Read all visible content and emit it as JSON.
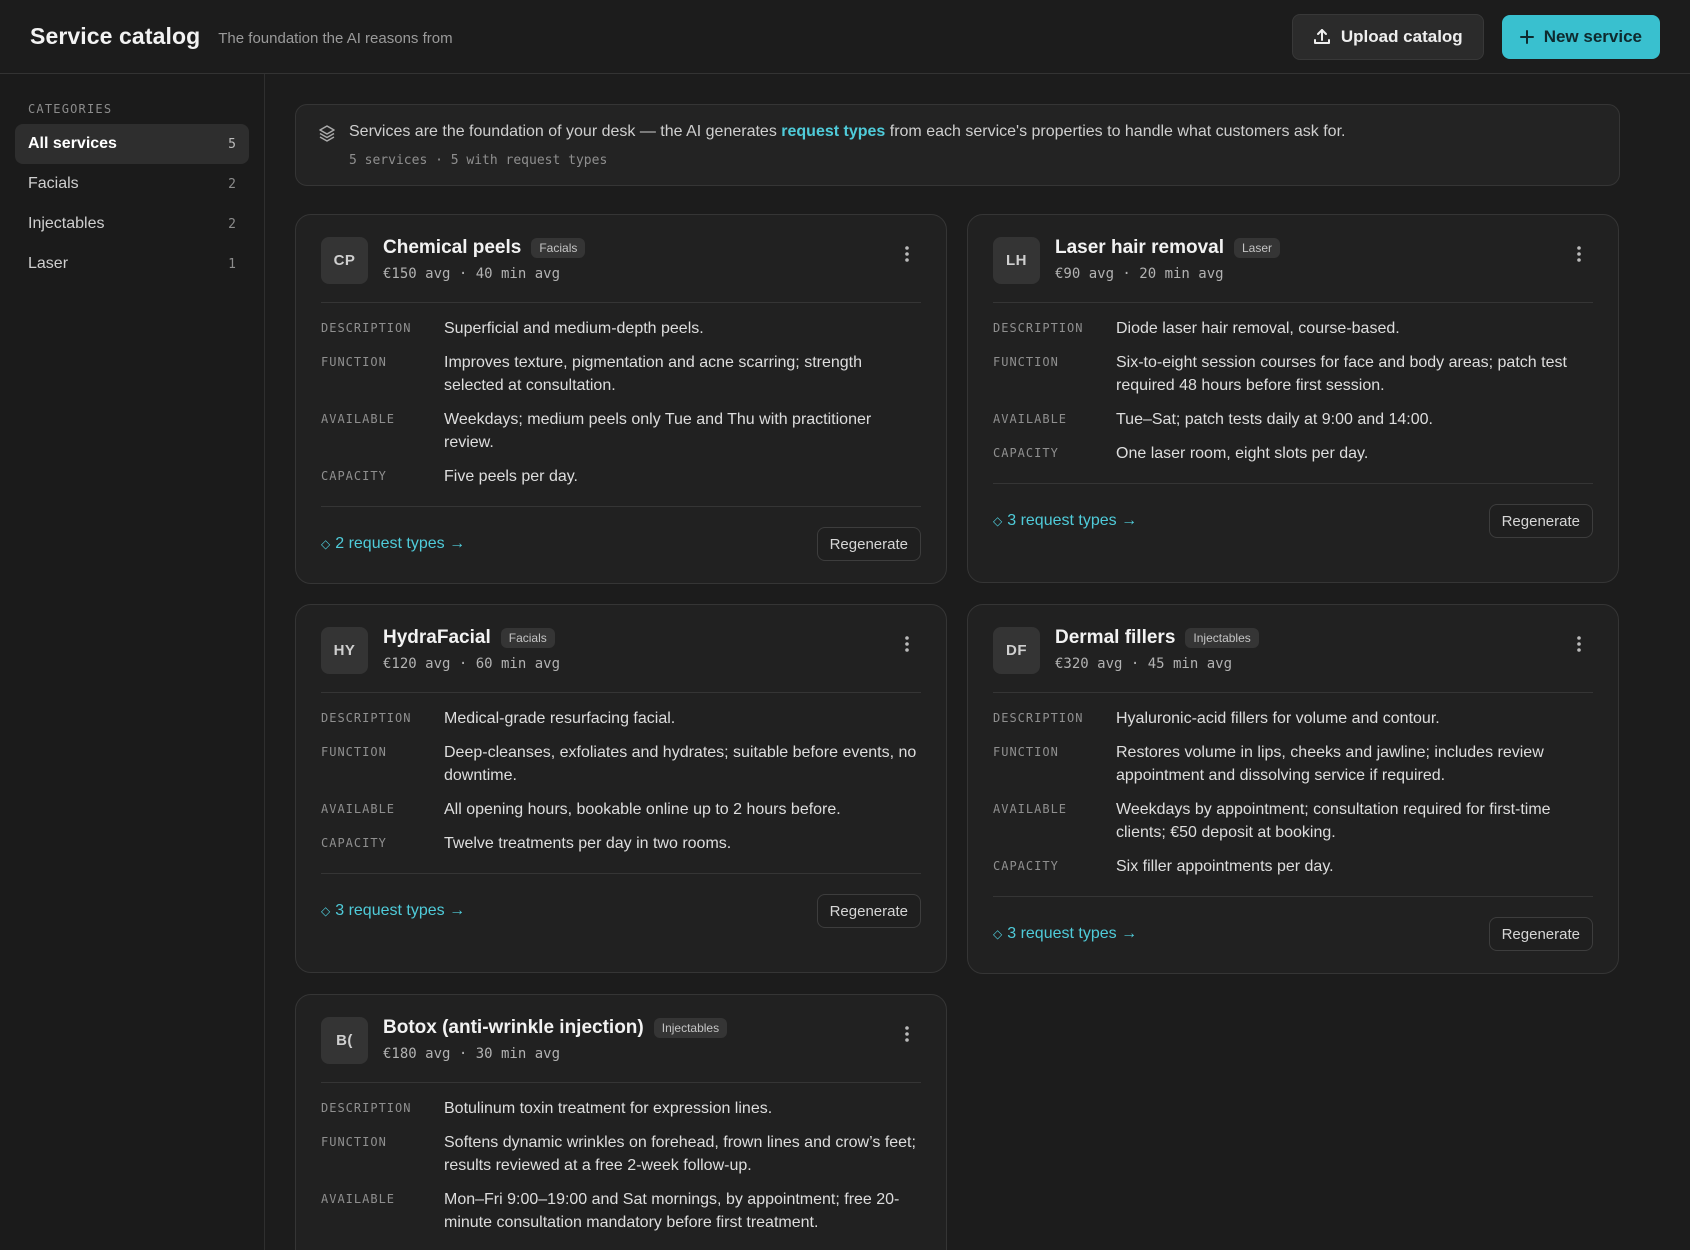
{
  "header": {
    "title": "Service catalog",
    "subtitle": "The foundation the AI reasons from",
    "upload_label": "Upload catalog",
    "new_label": "New service"
  },
  "sidebar": {
    "heading": "CATEGORIES",
    "items": [
      {
        "label": "All services",
        "count": "5",
        "active": true
      },
      {
        "label": "Facials",
        "count": "2"
      },
      {
        "label": "Injectables",
        "count": "2"
      },
      {
        "label": "Laser",
        "count": "1"
      }
    ]
  },
  "banner": {
    "text_before": "Services are the foundation of your desk — the AI generates ",
    "link": "request types",
    "text_after": " from each service's properties to handle what customers ask for.",
    "meta": "5 services · 5 with request types"
  },
  "labels": {
    "description": "DESCRIPTION",
    "function": "FUNCTION",
    "available": "AVAILABLE",
    "capacity": "CAPACITY",
    "regenerate": "Regenerate"
  },
  "services": [
    {
      "initials": "CP",
      "name": "Chemical peels",
      "category": "Facials",
      "stats": "€150 avg · 40 min avg",
      "description": "Superficial and medium-depth peels.",
      "function": "Improves texture, pigmentation and acne scarring; strength selected at consultation.",
      "available": "Weekdays; medium peels only Tue and Thu with practitioner review.",
      "capacity": "Five peels per day.",
      "request_types": "2 request types →"
    },
    {
      "initials": "LH",
      "name": "Laser hair removal",
      "category": "Laser",
      "stats": "€90 avg · 20 min avg",
      "description": "Diode laser hair removal, course-based.",
      "function": "Six-to-eight session courses for face and body areas; patch test required 48 hours before first session.",
      "available": "Tue–Sat; patch tests daily at 9:00 and 14:00.",
      "capacity": "One laser room, eight slots per day.",
      "request_types": "3 request types →"
    },
    {
      "initials": "HY",
      "name": "HydraFacial",
      "category": "Facials",
      "stats": "€120 avg · 60 min avg",
      "description": "Medical-grade resurfacing facial.",
      "function": "Deep-cleanses, exfoliates and hydrates; suitable before events, no downtime.",
      "available": "All opening hours, bookable online up to 2 hours before.",
      "capacity": "Twelve treatments per day in two rooms.",
      "request_types": "3 request types →"
    },
    {
      "initials": "DF",
      "name": "Dermal fillers",
      "category": "Injectables",
      "stats": "€320 avg · 45 min avg",
      "description": "Hyaluronic-acid fillers for volume and contour.",
      "function": "Restores volume in lips, cheeks and jawline; includes review appointment and dissolving service if required.",
      "available": "Weekdays by appointment; consultation required for first-time clients; €50 deposit at booking.",
      "capacity": "Six filler appointments per day.",
      "request_types": "3 request types →"
    },
    {
      "initials": "B(",
      "name": "Botox (anti-wrinkle injection)",
      "category": "Injectables",
      "stats": "€180 avg · 30 min avg",
      "description": "Botulinum toxin treatment for expression lines.",
      "function": "Softens dynamic wrinkles on forehead, frown lines and crow’s feet; results reviewed at a free 2-week follow-up.",
      "available": "Mon–Fri 9:00–19:00 and Sat mornings, by appointment; free 20-minute consultation mandatory before first treatment.",
      "capacity": "",
      "request_types": ""
    }
  ]
}
